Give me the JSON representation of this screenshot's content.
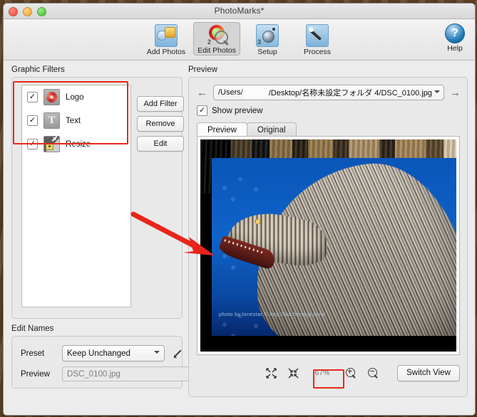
{
  "window": {
    "title": "PhotoMarks*",
    "controls": [
      "close",
      "minimize",
      "maximize"
    ]
  },
  "toolbar": {
    "items": [
      {
        "label": "Add Photos",
        "icon": "add-photos-icon",
        "selected": false
      },
      {
        "label": "Edit Photos",
        "icon": "edit-photos-icon",
        "selected": true
      },
      {
        "label": "Setup",
        "icon": "setup-icon",
        "selected": false
      },
      {
        "label": "Process",
        "icon": "process-icon",
        "selected": false
      }
    ],
    "help": {
      "label": "Help",
      "icon": "help-icon",
      "glyph": "?"
    }
  },
  "left": {
    "graphic_filters_label": "Graphic Filters",
    "filters": [
      {
        "label": "Logo",
        "checked": true,
        "check_glyph": "✓",
        "icon": "logo-filter-icon"
      },
      {
        "label": "Text",
        "checked": true,
        "check_glyph": "✓",
        "icon": "text-filter-icon",
        "glyph": "T"
      },
      {
        "label": "Resize",
        "checked": true,
        "check_glyph": "✓",
        "icon": "resize-filter-icon"
      }
    ],
    "buttons": [
      {
        "label": "Add Filter"
      },
      {
        "label": "Remove"
      },
      {
        "label": "Edit"
      }
    ],
    "edit_names_label": "Edit Names",
    "preset_label": "Preset",
    "preset_value": "Keep Unchanged",
    "preview_label": "Preview",
    "preview_value": "DSC_0100.jpg"
  },
  "right": {
    "preview_group_label": "Preview",
    "path": {
      "prefix": "/Users/",
      "redacted": true,
      "suffix": "/Desktop/名称未設定フォルダ 4/DSC_0100.jpg"
    },
    "back_glyph": "←",
    "forward_glyph": "→",
    "show_preview": {
      "label": "Show preview",
      "checked": true,
      "check_glyph": "✓"
    },
    "tabs": [
      {
        "label": "Preview",
        "active": true
      },
      {
        "label": "Original",
        "active": false
      }
    ],
    "image_watermark": "photo by lonestar © http://lab.hendigi.com/",
    "tools": {
      "fit_window_icon": "fit-to-window-icon",
      "actual_size_icon": "fit-expand-icon",
      "zoom_level": "67%",
      "zoom_in_icon": "zoom-in-icon",
      "zoom_out_icon": "zoom-out-icon",
      "switch_view_label": "Switch View"
    }
  },
  "annotations": {
    "highlight_color": "#e9291c",
    "boxes": [
      "graphic-filters-list",
      "zoom-level-field"
    ],
    "arrow": {
      "from": "graphic-filters-list",
      "to": "preview-image"
    }
  }
}
